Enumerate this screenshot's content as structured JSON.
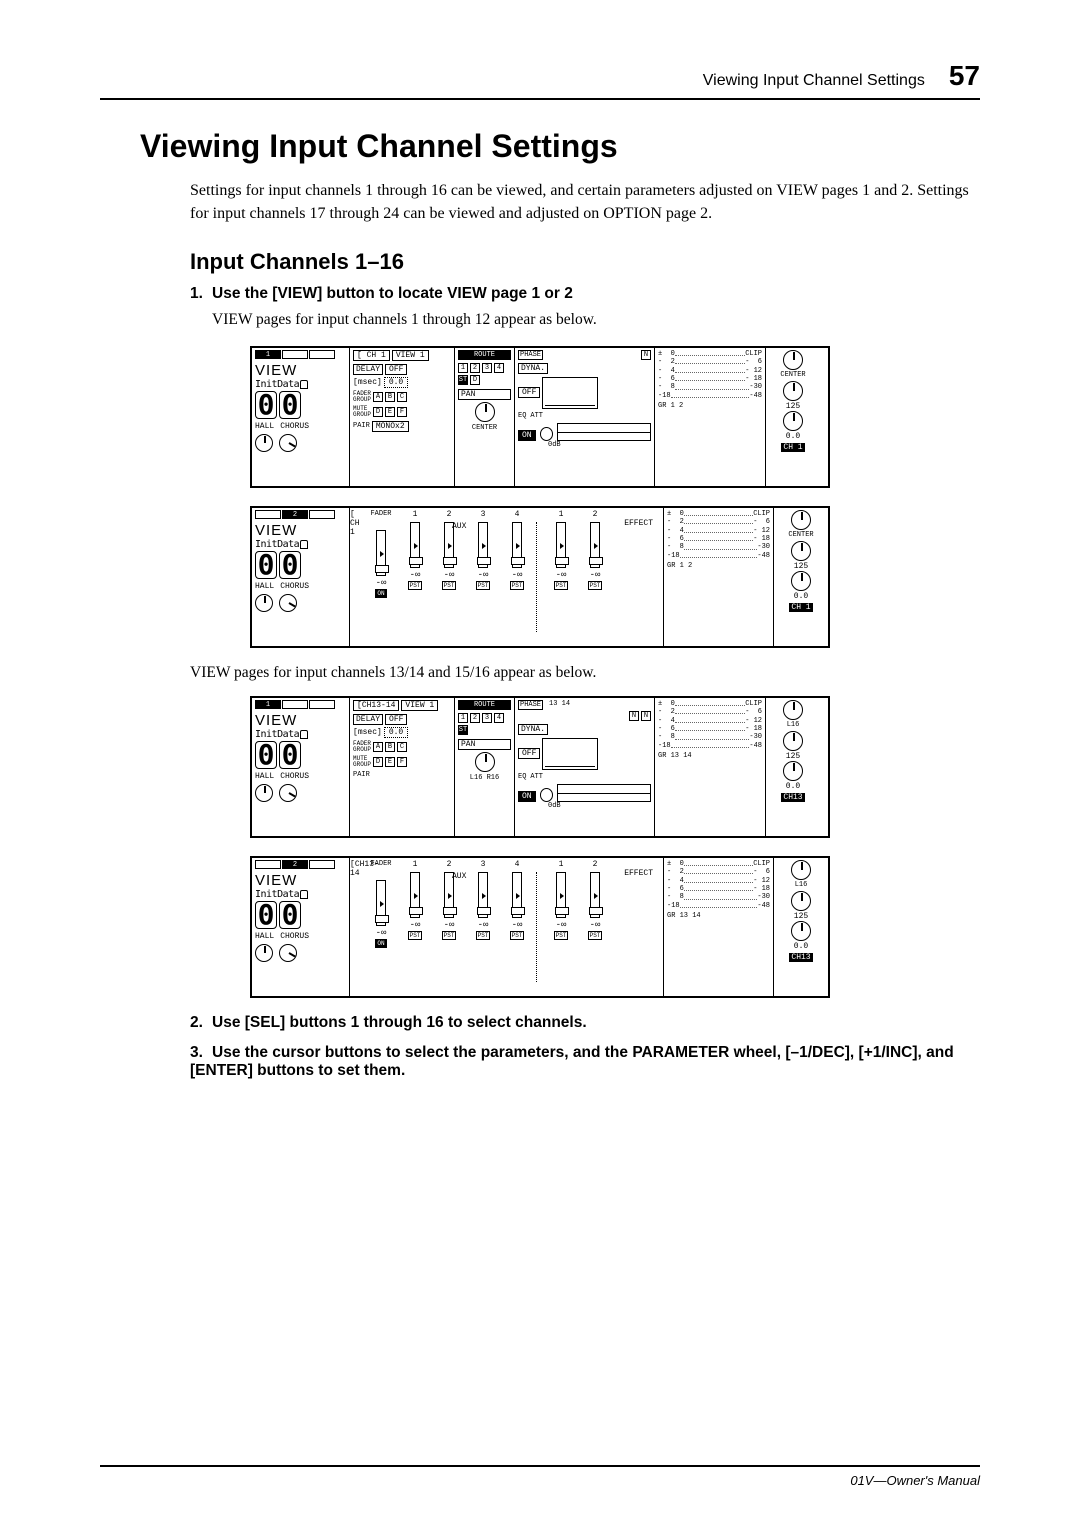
{
  "header": {
    "title": "Viewing Input Channel Settings",
    "page": "57"
  },
  "h1": "Viewing Input Channel Settings",
  "intro": "Settings for input channels 1 through 16 can be viewed, and certain parameters adjusted on VIEW pages 1 and 2. Settings for input channels 17 through 24 can be viewed and adjusted on OPTION page 2.",
  "h2": "Input Channels 1–16",
  "steps": {
    "1": {
      "num": "1.",
      "title": "Use the [VIEW] button to locate VIEW page 1 or 2",
      "desc": "VIEW pages for input channels 1 through 12 appear as below."
    },
    "2": {
      "num": "2.",
      "title": "Use [SEL] buttons 1 through 16 to select channels."
    },
    "3": {
      "num": "3.",
      "title": "Use the cursor buttons to select the parameters, and the PARAMETER wheel, [–1/DEC], [+1/INC], and [ENTER] buttons to set them."
    }
  },
  "mid_text": "VIEW pages for input channels 13/14 and 15/16 appear as below.",
  "lcd": {
    "view": "VIEW",
    "init": "InitData",
    "hall": "HALL",
    "chorus": "CHORUS",
    "ch1": "CH 1",
    "ch1314": "CH13-14",
    "viewtab": "VIEW 1",
    "delay": "DELAY",
    "off": "OFF",
    "msec": "msec]",
    "msec_val": "0.0",
    "fader_group": "FADER\nGROUP",
    "mute_group": "MUTE\nGROUP",
    "pair": "PAIR",
    "mono": "MONOx2",
    "route": "ROUTE",
    "pan": "PAN",
    "center": "CENTER",
    "l16r16": "L16 R16",
    "phase": "PHASE",
    "n": "N",
    "dyna": "DYNA.",
    "eq": "EQ",
    "att": "ATT",
    "on": "ON",
    "zerodb": "0dB",
    "clip": "CLIP",
    "scale": [
      "0",
      "2",
      "4",
      "6",
      "8",
      "-18"
    ],
    "scale_r": [
      "6",
      "12",
      "18",
      "30",
      "48"
    ],
    "gr12": "GR  1   2",
    "gr1314": "GR 13 14",
    "ch13_14": "13    14",
    "center_r": "CENTER",
    "l16": "L16",
    "val125": "125",
    "val00": "0.0",
    "badge1": "CH 1",
    "badge13": "CH13",
    "fader": "FADER",
    "aux": "AUX",
    "effect": "EFFECT",
    "inf": "-∞",
    "pst": "PST",
    "nums": [
      "1",
      "2",
      "3",
      "4"
    ],
    "effnums": [
      "1",
      "2"
    ],
    "st": "ST",
    "d": "D",
    "a": "A",
    "b": "B",
    "c": "C",
    "de": "D",
    "e": "E",
    "f": "F"
  },
  "footer": "01V—Owner's Manual"
}
